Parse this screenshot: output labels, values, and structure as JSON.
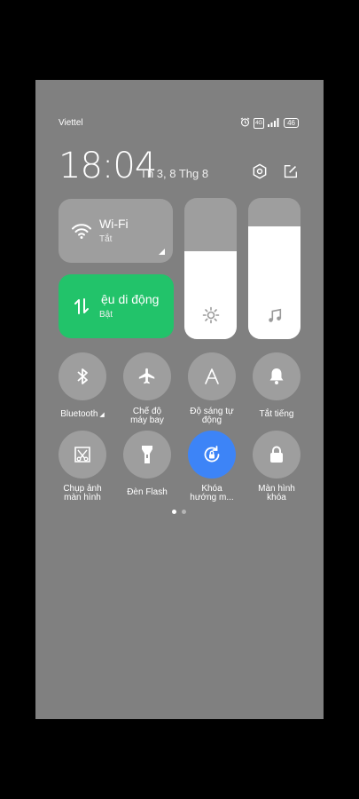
{
  "status": {
    "carrier": "Viettel",
    "alarm_icon": "alarm-icon",
    "signal_type": "4G",
    "battery": "46"
  },
  "header": {
    "time": "18:04",
    "date": "Th 3, 8 Thg 8",
    "settings_icon": "gear-icon",
    "edit_icon": "edit-icon"
  },
  "tiles": {
    "wifi": {
      "title": "Wi-Fi",
      "status": "Tắt"
    },
    "mobile_data": {
      "title": "ệu di động",
      "status": "Bật",
      "color": "#22c36a"
    }
  },
  "sliders": {
    "brightness": {
      "level_pct": 62,
      "icon": "sun-icon"
    },
    "volume": {
      "level_pct": 80,
      "icon": "music-note-icon"
    }
  },
  "toggles": [
    {
      "label": "Bluetooth",
      "icon": "bluetooth-icon",
      "active": false
    },
    {
      "label": "Chế độ máy bay",
      "label_line1": "Chế độ",
      "label_line2": "máy bay",
      "icon": "airplane-icon",
      "active": false
    },
    {
      "label_line1": "Độ sáng tự",
      "label_line2": "động",
      "icon": "auto-brightness-icon",
      "active": false
    },
    {
      "label": "Tắt tiếng",
      "icon": "bell-icon",
      "active": false
    },
    {
      "label_line1": "Chụp ảnh",
      "label_line2": "màn hình",
      "icon": "screenshot-icon",
      "active": false
    },
    {
      "label": "Đèn Flash",
      "icon": "flashlight-icon",
      "active": false
    },
    {
      "label_line1": "Khóa",
      "label_line2": "hướng m...",
      "icon": "rotation-lock-icon",
      "active": true,
      "color": "#3d84f7"
    },
    {
      "label_line1": "Màn hình",
      "label_line2": "khóa",
      "icon": "lock-icon",
      "active": false
    }
  ],
  "pager": {
    "current": 1,
    "total": 2
  }
}
